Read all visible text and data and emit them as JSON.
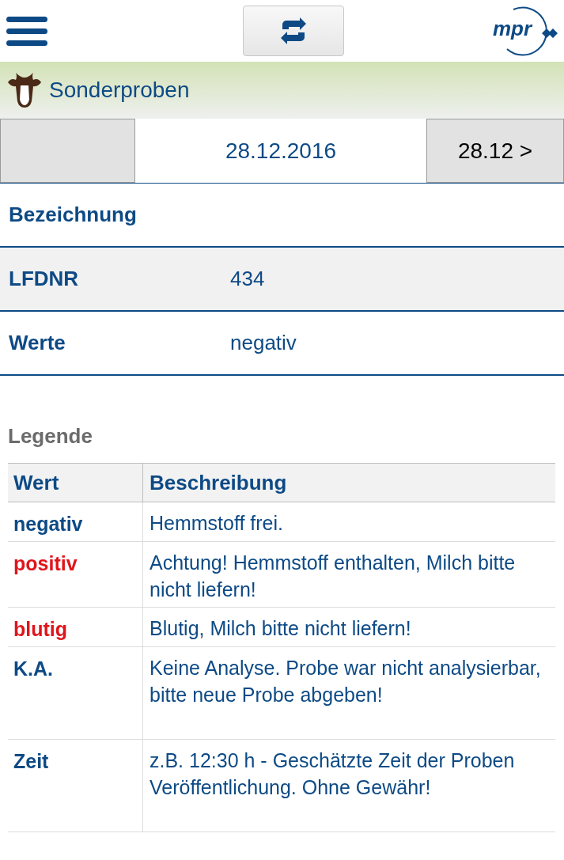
{
  "header": {
    "logo": "mpr"
  },
  "section": {
    "title": "Sonderproben"
  },
  "date_nav": {
    "current": "28.12.2016",
    "next": "28.12 >"
  },
  "details": [
    {
      "label": "Bezeichnung",
      "shaded": false
    },
    {
      "label": "LFDNR",
      "value": "434",
      "shaded": true
    },
    {
      "label": "Werte",
      "value": "negativ",
      "shaded": false
    }
  ],
  "legend": {
    "title": "Legende",
    "columns": [
      "Wert",
      "Beschreibung"
    ],
    "rows": [
      {
        "value": "negativ",
        "color": "#0d4a85",
        "description": "Hemmstoff frei."
      },
      {
        "value": "positiv",
        "color": "#e0141b",
        "description": "Achtung! Hemmstoff enthalten, Milch bitte nicht liefern!"
      },
      {
        "value": "blutig",
        "color": "#e0141b",
        "description": "Blutig, Milch bitte nicht liefern!"
      },
      {
        "value": "K.A.",
        "color": "#0d4a85",
        "description": "Keine Analyse. Probe war nicht analysierbar, bitte neue Probe abgeben!"
      },
      {
        "value": "Zeit",
        "color": "#0d4a85",
        "description": "z.B. 12:30 h - Geschätzte Zeit der Proben Veröffentlichung. Ohne Gewähr!"
      }
    ]
  }
}
